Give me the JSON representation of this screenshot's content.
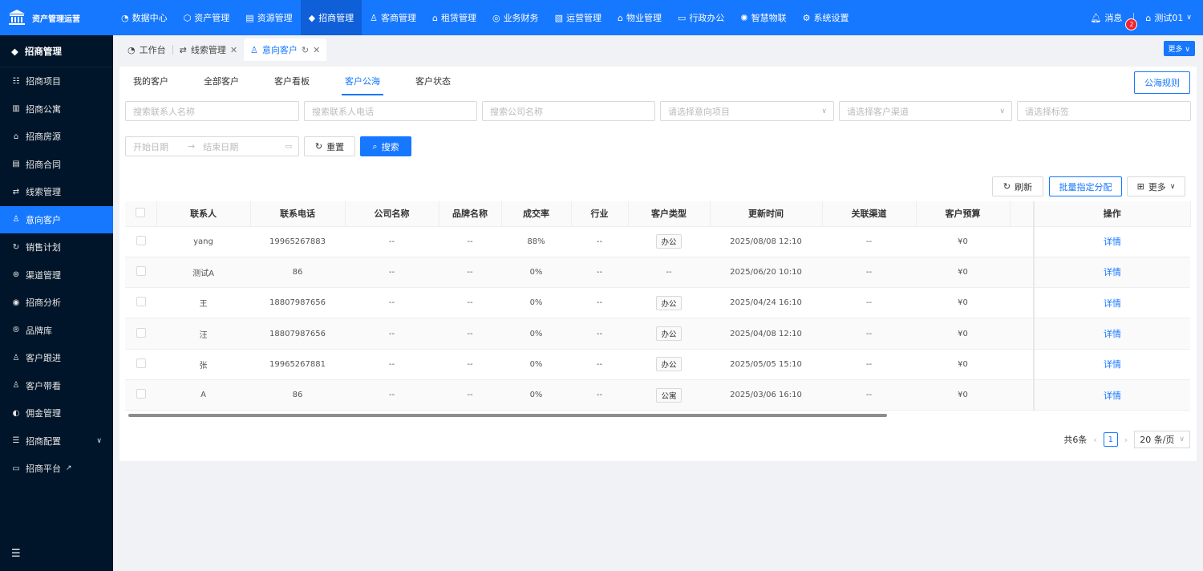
{
  "app": {
    "title": "资产管理运营"
  },
  "topnav": [
    {
      "icon": "◔",
      "label": "数据中心"
    },
    {
      "icon": "⬡",
      "label": "资产管理"
    },
    {
      "icon": "▤",
      "label": "资源管理"
    },
    {
      "icon": "◆",
      "label": "招商管理"
    },
    {
      "icon": "♙",
      "label": "客商管理"
    },
    {
      "icon": "⌂",
      "label": "租赁管理"
    },
    {
      "icon": "◎",
      "label": "业务财务"
    },
    {
      "icon": "▧",
      "label": "运营管理"
    },
    {
      "icon": "⌂",
      "label": "物业管理"
    },
    {
      "icon": "▭",
      "label": "行政办公"
    },
    {
      "icon": "✺",
      "label": "智慧物联"
    },
    {
      "icon": "⚙",
      "label": "系统设置"
    }
  ],
  "header_right": {
    "messages_label": "消息",
    "messages_count": "2",
    "user": "测试01"
  },
  "sidebar": {
    "title": "招商管理",
    "items": [
      {
        "icon": "☷",
        "label": "招商项目"
      },
      {
        "icon": "▥",
        "label": "招商公寓"
      },
      {
        "icon": "⌂",
        "label": "招商房源"
      },
      {
        "icon": "▤",
        "label": "招商合同"
      },
      {
        "icon": "⇄",
        "label": "线索管理"
      },
      {
        "icon": "♙",
        "label": "意向客户"
      },
      {
        "icon": "↻",
        "label": "销售计划"
      },
      {
        "icon": "⊛",
        "label": "渠道管理"
      },
      {
        "icon": "◉",
        "label": "招商分析"
      },
      {
        "icon": "®",
        "label": "品牌库"
      },
      {
        "icon": "♙",
        "label": "客户跟进"
      },
      {
        "icon": "♙",
        "label": "客户带看"
      },
      {
        "icon": "◐",
        "label": "佣金管理"
      },
      {
        "icon": "☰",
        "label": "招商配置"
      },
      {
        "icon": "▭",
        "label": "招商平台"
      }
    ]
  },
  "tabs": [
    {
      "label": "工作台"
    },
    {
      "label": "线索管理"
    },
    {
      "label": "意向客户"
    }
  ],
  "more_label": "更多",
  "subtabs": [
    "我的客户",
    "全部客户",
    "客户看板",
    "客户公海",
    "客户状态"
  ],
  "rules_button": "公海规则",
  "filters": {
    "contact_name": "搜索联系人名称",
    "contact_phone": "搜索联系人电话",
    "company": "搜索公司名称",
    "project": "请选择意向项目",
    "channel": "请选择客户渠道",
    "tag": "请选择标签",
    "start_date": "开始日期",
    "end_date": "结束日期",
    "reset": "重置",
    "search": "搜索"
  },
  "toolbar": {
    "refresh": "刷新",
    "batch_assign": "批量指定分配",
    "more": "更多"
  },
  "table": {
    "headers": [
      "联系人",
      "联系电话",
      "公司名称",
      "品牌名称",
      "成交率",
      "行业",
      "客户类型",
      "更新时间",
      "关联渠道",
      "客户预算",
      "操作"
    ],
    "rows": [
      {
        "name": "yang",
        "phone": "19965267883",
        "company": "--",
        "brand": "--",
        "rate": "88%",
        "industry": "--",
        "type": "办公",
        "updated": "2025/08/08 12:10",
        "channel": "--",
        "budget": "¥0",
        "action": "详情"
      },
      {
        "name": "测试A",
        "phone": "86",
        "company": "--",
        "brand": "--",
        "rate": "0%",
        "industry": "--",
        "type": "--",
        "updated": "2025/06/20 10:10",
        "channel": "--",
        "budget": "¥0",
        "action": "详情"
      },
      {
        "name": "王",
        "phone": "18807987656",
        "company": "--",
        "brand": "--",
        "rate": "0%",
        "industry": "--",
        "type": "办公",
        "updated": "2025/04/24 16:10",
        "channel": "--",
        "budget": "¥0",
        "action": "详情"
      },
      {
        "name": "汪",
        "phone": "18807987656",
        "company": "--",
        "brand": "--",
        "rate": "0%",
        "industry": "--",
        "type": "办公",
        "updated": "2025/04/08 12:10",
        "channel": "--",
        "budget": "¥0",
        "action": "详情"
      },
      {
        "name": "张",
        "phone": "19965267881",
        "company": "--",
        "brand": "--",
        "rate": "0%",
        "industry": "--",
        "type": "办公",
        "updated": "2025/05/05 15:10",
        "channel": "--",
        "budget": "¥0",
        "action": "详情"
      },
      {
        "name": "A",
        "phone": "86",
        "company": "--",
        "brand": "--",
        "rate": "0%",
        "industry": "--",
        "type": "公寓",
        "updated": "2025/03/06 16:10",
        "channel": "--",
        "budget": "¥0",
        "action": "详情"
      }
    ]
  },
  "pagination": {
    "total": "共6条",
    "current": "1",
    "page_size": "20 条/页"
  },
  "colors": {
    "primary": "#1677ff",
    "sidebar_bg": "#001529"
  }
}
